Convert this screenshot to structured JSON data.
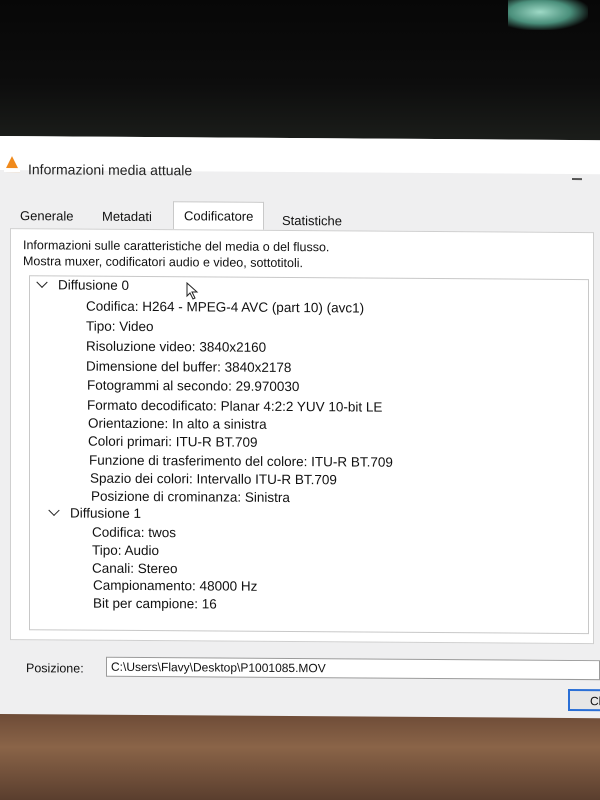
{
  "window": {
    "title": "Informazioni media attuale"
  },
  "tabs": [
    {
      "label": "Generale"
    },
    {
      "label": "Metadati"
    },
    {
      "label": "Codificatore"
    },
    {
      "label": "Statistiche"
    }
  ],
  "panel": {
    "description_line1": "Informazioni sulle caratteristiche del media o del flusso.",
    "description_line2": "Mostra muxer, codificatori audio e video, sottotitoli."
  },
  "streams": [
    {
      "name": "Diffusione 0",
      "items": [
        "Codifica: H264 - MPEG-4 AVC (part 10) (avc1)",
        "Tipo: Video",
        "Risoluzione video: 3840x2160",
        "Dimensione del buffer: 3840x2178",
        "Fotogrammi al secondo: 29.970030",
        "Formato decodificato: Planar 4:2:2 YUV 10-bit LE",
        "Orientazione: In alto a sinistra",
        "Colori primari: ITU-R BT.709",
        "Funzione di trasferimento del colore: ITU-R BT.709",
        "Spazio dei colori: Intervallo ITU-R BT.709",
        "Posizione di crominanza: Sinistra"
      ]
    },
    {
      "name": "Diffusione 1",
      "items": [
        "Codifica: twos",
        "Tipo: Audio",
        "Canali: Stereo",
        "Campionamento: 48000 Hz",
        "Bit per campione: 16"
      ]
    }
  ],
  "position": {
    "label": "Posizione:",
    "value": "C:\\Users\\Flavy\\Desktop\\P1001085.MOV"
  },
  "buttons": {
    "close_label": "Cl"
  },
  "colors": {
    "accent": "#2a6fd6",
    "vlc_orange": "#f08a1c"
  }
}
